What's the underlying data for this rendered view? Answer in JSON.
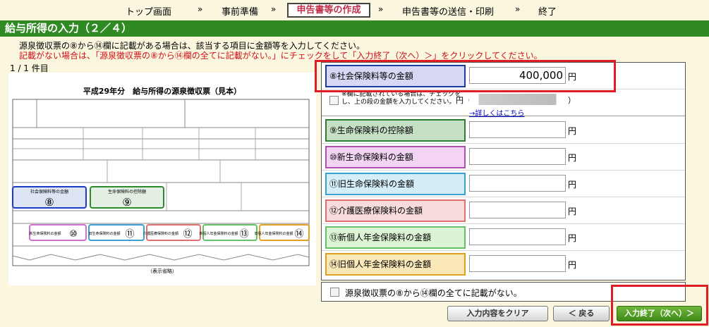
{
  "nav": {
    "items": [
      "トップ画面",
      "事前準備",
      "申告書等の作成",
      "申告書等の送信・印刷",
      "終了"
    ],
    "arrow": "»"
  },
  "title": "給与所得の入力（２／４）",
  "instructions": {
    "line1": "源泉徴収票の⑧から⑭欄に記載がある場合は、該当する項目に金額等を入力してください。",
    "line2": "記載がない場合は、「源泉徴収票の⑧から⑭欄の全てに記載がない。」にチェックをして「入力終了（次へ）＞」をクリックしてください。"
  },
  "count": "1 / 1 件目",
  "slip": {
    "title": "平成29年分　給与所得の源泉徴収票（見本）",
    "label8": "社会保険料等の金額",
    "label9": "生命保険料の控除額",
    "num8": "⑧",
    "num9": "⑨",
    "num10": "⑩",
    "num11": "⑪",
    "num12": "⑫",
    "num13": "⑬",
    "num14": "⑭",
    "label10": "新生命保険料の金額",
    "label11": "旧生命保険料の金額",
    "label12": "介護医療保険料の金額",
    "label13": "新個人年金保険料の金額",
    "label14": "旧個人年金保険料の金額",
    "footer": "（表示省略）"
  },
  "form": {
    "rows": [
      {
        "label": "⑧社会保険料等の金額",
        "value": "400,000",
        "color": "#d8d8f4",
        "border": "#1a3a9c"
      },
      {
        "label": "⑨生命保険料の控除額",
        "value": "",
        "color": "#c6e0c6",
        "border": "#2e7d32"
      },
      {
        "label": "⑩新生命保険料の金額",
        "value": "",
        "color": "#f4d4f4",
        "border": "#b050b0"
      },
      {
        "label": "⑪旧生命保険料の金額",
        "value": "",
        "color": "#d4eef8",
        "border": "#3aa0d0"
      },
      {
        "label": "⑫介護医療保険料の金額",
        "value": "",
        "color": "#f8dcdc",
        "border": "#e07070"
      },
      {
        "label": "⑬新個人年金保険料の金額",
        "value": "",
        "color": "#dcf4d4",
        "border": "#66c06a"
      },
      {
        "label": "⑭旧個人年金保険料の金額",
        "value": "",
        "color": "#fbe8b8",
        "border": "#e0a020"
      }
    ],
    "yen": "円",
    "sub_text": "※欄に記載されている場合は、チェックをし、上の段の金額を入力してください。",
    "sub_yen": "円（",
    "sub_paren": "）",
    "link": "→詳しくはこちら"
  },
  "no_entry_label": "源泉徴収票の⑧から⑭欄の全てに記載がない。",
  "buttons": {
    "clear": "入力内容をクリア",
    "back": "＜ 戻る",
    "next": "入力終了（次へ）＞"
  }
}
